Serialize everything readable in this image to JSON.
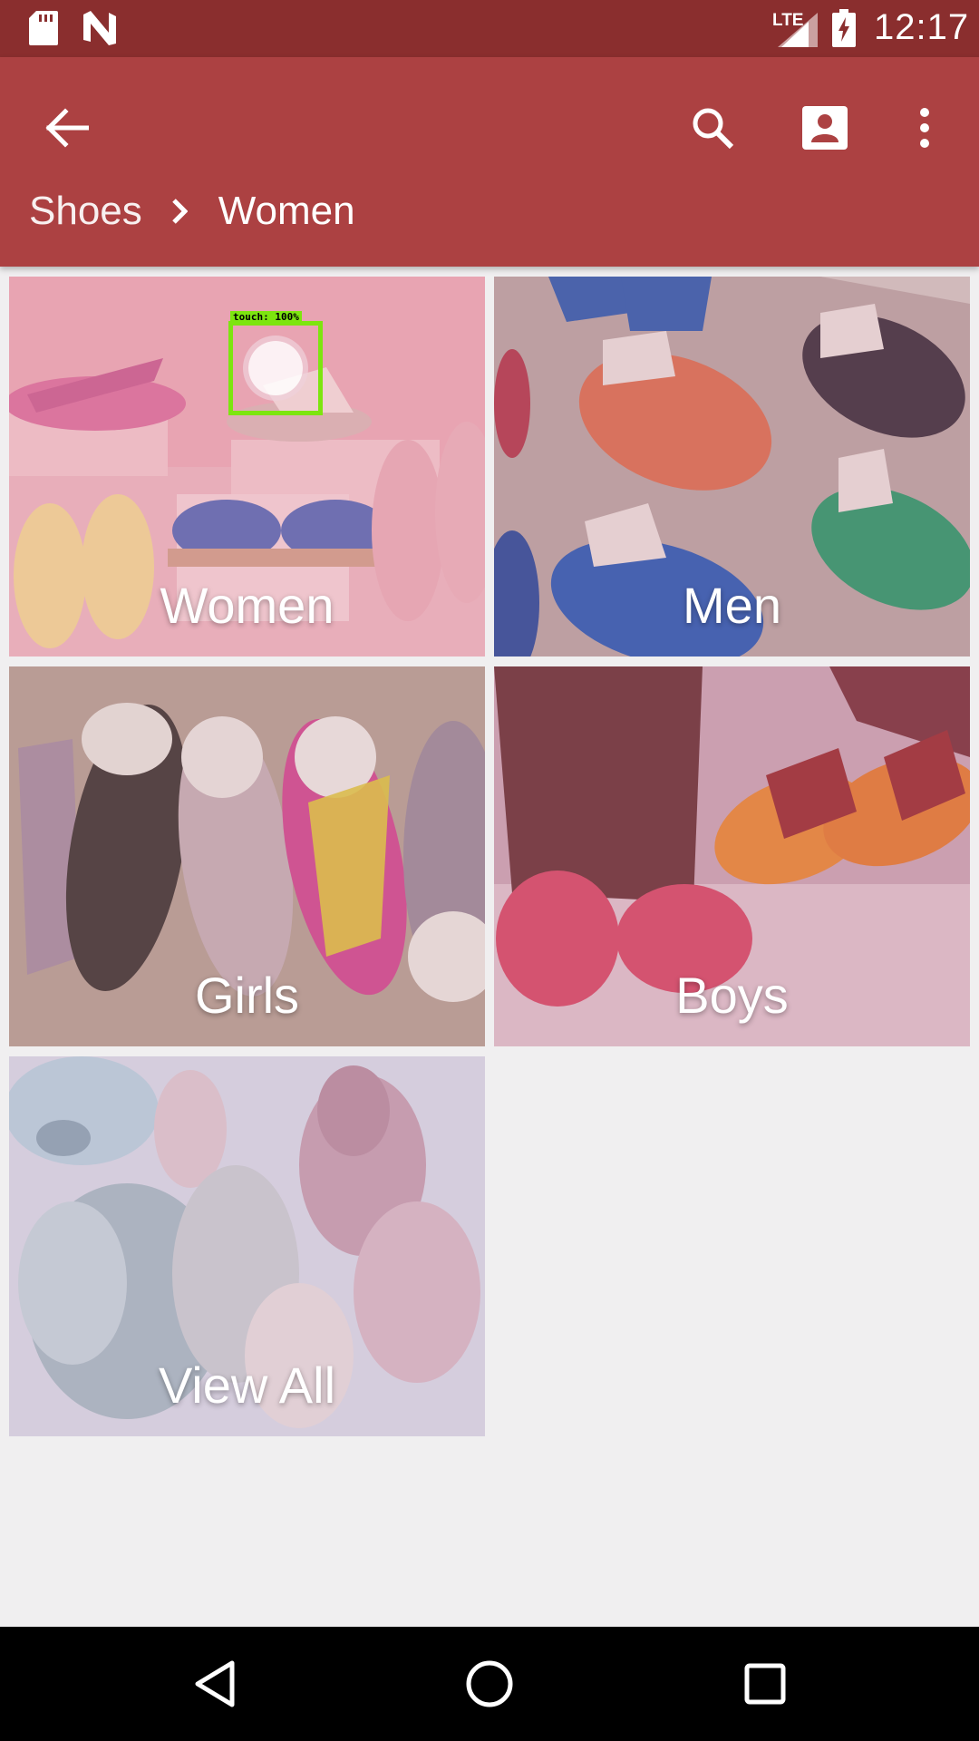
{
  "status_bar": {
    "network_label": "LTE",
    "time": "12:17",
    "icons": [
      "sd-card-icon",
      "n-notification-icon",
      "signal-icon",
      "battery-charging-icon"
    ]
  },
  "app_bar": {
    "breadcrumb": [
      "Shoes",
      "Women"
    ],
    "icons": [
      "back-arrow-icon",
      "search-icon",
      "account-icon",
      "more-vert-icon"
    ],
    "color": "#ac4142"
  },
  "categories": [
    {
      "label": "Women"
    },
    {
      "label": "Men"
    },
    {
      "label": "Girls"
    },
    {
      "label": "Boys"
    },
    {
      "label": "View All"
    }
  ],
  "touch_indicator": {
    "label": "touch: 100%"
  },
  "nav_bar": {
    "icons": [
      "back-triangle-icon",
      "home-circle-icon",
      "recents-square-icon"
    ]
  }
}
